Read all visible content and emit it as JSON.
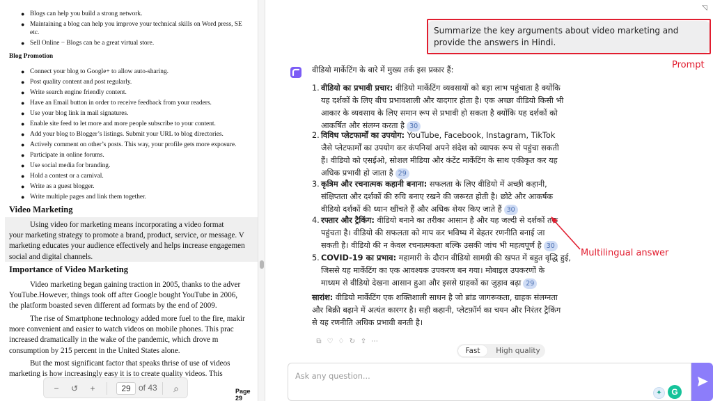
{
  "pdf": {
    "top_bullets": [
      "Blogs can help you build a strong network.",
      "Maintaining a blog can help you improve your technical skills on Word press, SE",
      "etc.",
      "Sell Online − Blogs can be a great virtual store."
    ],
    "blog_promotion_heading": "Blog Promotion",
    "promotion_items": [
      "Connect your blog to Google+ to allow auto-sharing.",
      "Post quality content and post regularly.",
      "Write search engine friendly content.",
      "Have an Email button in order to receive feedback from your readers.",
      "Use your blog link in mail signatures.",
      "Enable site feed to let more and more people subscribe to your content.",
      "Add your blog to Blogger’s listings. Submit your URL to blog directories.",
      "Actively comment on other’s posts. This way, your profile gets more exposure.",
      "Participate in online forums.",
      "Use social media for branding.",
      "Hold a contest or a carnival.",
      "Write as a guest blogger.",
      "Write multiple pages and link them together."
    ],
    "video_marketing_heading": "Video Marketing",
    "video_marketing_lines": [
      "Using video for marketing means incorporating a video format",
      "your marketing strategy to promote a brand, product, service, or message. V",
      "marketing educates your audience effectively and helps increase engagemen",
      "social and digital channels."
    ],
    "importance_heading": "Importance of Video Marketing",
    "importance_lines": [
      "Video marketing began gaining traction in 2005, thanks to the adver",
      "YouTube.However, things took off after Google bought YouTube in 2006,",
      "the platform boasted seven different ad formats by the end of 2009."
    ],
    "rise_lines": [
      "The rise of Smartphone technology added more fuel to the fire, makir",
      "more convenient and easier to watch videos on mobile phones. This prac",
      "increased dramatically in the wake of the pandemic, which drove m",
      "consumption by 215 percent in the United States alone."
    ],
    "last_lines": [
      "But the most significant factor that speaks thrise of use of videos",
      "marketing is how increasingly easy it is to create quality videos. This"
    ],
    "toolbar": {
      "zoom_out": "−",
      "rotate": "↺",
      "zoom_in": "+",
      "page_current": "29",
      "page_total": "of 43",
      "search": "⌕"
    },
    "page_footer": "Page 29"
  },
  "chat": {
    "user_prompt": "Summarize the key arguments about video marketing and provide the answers in Hindi.",
    "prompt_annotation": "Prompt",
    "multilingual_annotation": "Multilingual answer",
    "intro": "वीडियो मार्केटिंग के बारे में मुख्य तर्क इस प्रकार हैं:",
    "points": [
      {
        "num": "1.",
        "title": "वीडियो का प्रभावी प्रचार:",
        "first": " वीडियो मार्केटिंग व्यवसायों को बड़ा लाभ पहुंचाता है क्योंकि",
        "lines": [
          "यह दर्शकों के लिए बीच प्रभावशाली और यादगार होता है। एक अच्छा वीडियो किसी भी",
          "आकार के व्यवसाय के लिए समान रूप से प्रभावी हो सकता है क्योंकि यह दर्शकों को",
          "आकर्षित और संलग्न करता है"
        ],
        "cite": "30"
      },
      {
        "num": "2.",
        "title": "विविध प्लेटफार्मों का उपयोग:",
        "first": " YouTube, Facebook, Instagram, TikTok",
        "lines": [
          "जैसे प्लेटफार्मों का उपयोग कर कंपनियां अपने संदेश को व्यापक रूप से पहुंचा सकती",
          "हैं। वीडियो को एसईओ, सोशल मीडिया और कंटेंट मार्केटिंग के साथ एकीकृत कर यह",
          "अधिक प्रभावी हो जाता है"
        ],
        "cite": "29"
      },
      {
        "num": "3.",
        "title": "कृत्रिम और रचनात्मक कहानी बनाना:",
        "first": " सफलता के लिए वीडियो में अच्छी कहानी,",
        "lines": [
          "संक्षिप्तता और दर्शकों की रुचि बनाए रखने की जरूरत होती है। छोटे और आकर्षक",
          "वीडियो दर्शकों की ध्यान खींचते हैं और अधिक शेयर किए जाते हैं"
        ],
        "cite": "30"
      },
      {
        "num": "4.",
        "title": "रफ्तार और ट्रैकिंग:",
        "first": " वीडियो बनाने का तरीका आसान है और यह जल्दी से दर्शकों तक",
        "lines": [
          "पहुंचता है। वीडियो की सफलता को माप कर भविष्य में बेहतर रणनीति बनाई जा",
          "सकती है। वीडियो की न केवल रचनात्मकता बल्कि उसकी जांच भी महत्वपूर्ण है"
        ],
        "cite": "30"
      },
      {
        "num": "5.",
        "title": "COVID-19 का प्रभाव:",
        "first": " महामारी के दौरान वीडियो सामग्री की खपत में बहुत वृद्धि हुई,",
        "lines": [
          "जिससे यह मार्केटिंग का एक आवश्यक उपकरण बन गया। मोबाइल उपकरणों के",
          "माध्यम से वीडियो देखना आसान हुआ और इससे ग्राहकों का जुड़ाव बढ़ा"
        ],
        "cite": "29"
      }
    ],
    "summary_title": "सारांश:",
    "summary_first": " वीडियो मार्केटिंग एक शक्तिशाली साधन है जो ब्रांड जागरूकता, ग्राहक संलग्नता",
    "summary_lines": [
      "और बिक्री बढ़ाने में अत्यंत कारगर है। सही कहानी, प्लेटफ़ॉर्म का चयन और निरंतर ट्रैकिंग",
      "से यह रणनीति अधिक प्रभावी बनती है।"
    ],
    "toggle": {
      "fast": "Fast",
      "high_quality": "High quality"
    },
    "input_placeholder": "Ask any question...",
    "grammarly_letter": "G"
  }
}
